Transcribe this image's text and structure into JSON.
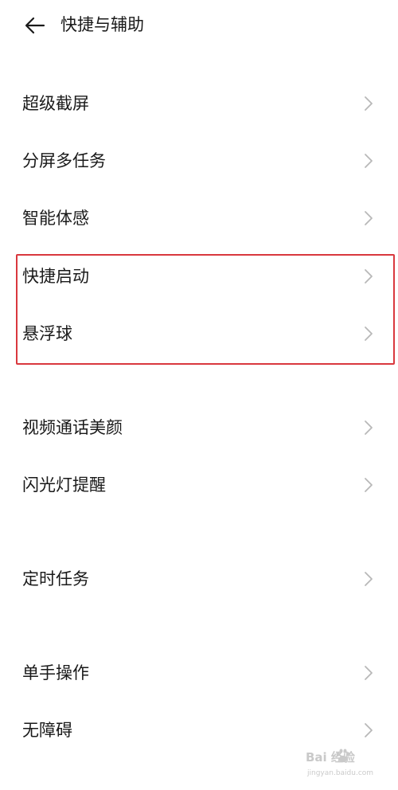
{
  "header": {
    "title": "快捷与辅助",
    "back_icon": "arrow-left-icon"
  },
  "settings_items": [
    {
      "label": "超级截屏"
    },
    {
      "label": "分屏多任务"
    },
    {
      "label": "智能体感"
    },
    {
      "label": "快捷启动"
    },
    {
      "label": "悬浮球"
    },
    {
      "label": "视频通话美颜"
    },
    {
      "label": "闪光灯提醒"
    },
    {
      "label": "定时任务"
    },
    {
      "label": "单手操作"
    },
    {
      "label": "无障碍"
    }
  ],
  "highlight": {
    "color": "#d9383e",
    "items": [
      "快捷启动",
      "悬浮球"
    ]
  },
  "chevron_icon": "chevron-right-icon",
  "watermark": {
    "top_text": "Bai 经验",
    "bottom_text": "jingyan.baidu.com"
  }
}
